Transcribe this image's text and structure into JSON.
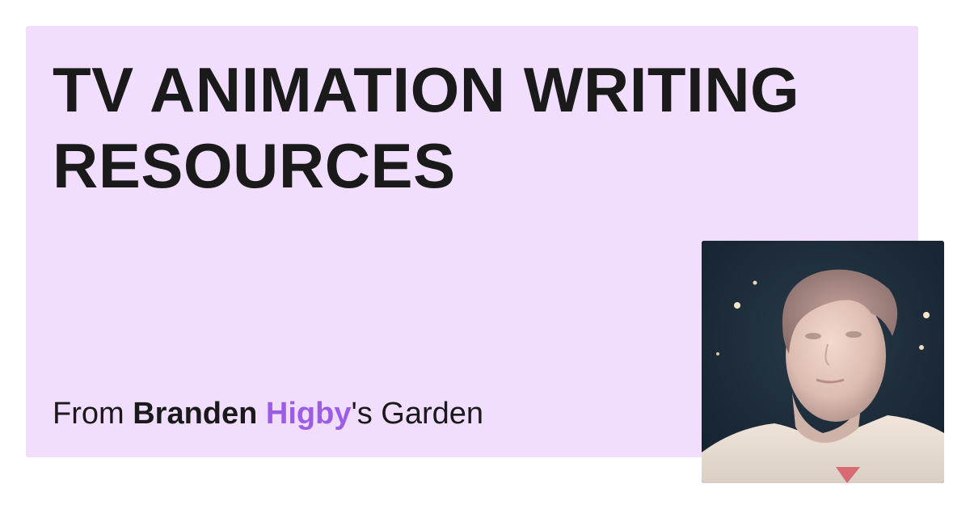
{
  "title": "TV ANIMATION WRITING RESOURCES",
  "byline": {
    "prefix": "From ",
    "first_name": "Branden",
    "space": " ",
    "last_name": "Higby",
    "suffix": "'s Garden"
  },
  "colors": {
    "card_background": "#f1ddfd",
    "accent": "#9b5de5",
    "text": "#1a1a1a"
  },
  "avatar": {
    "icon": "portrait-photo"
  }
}
